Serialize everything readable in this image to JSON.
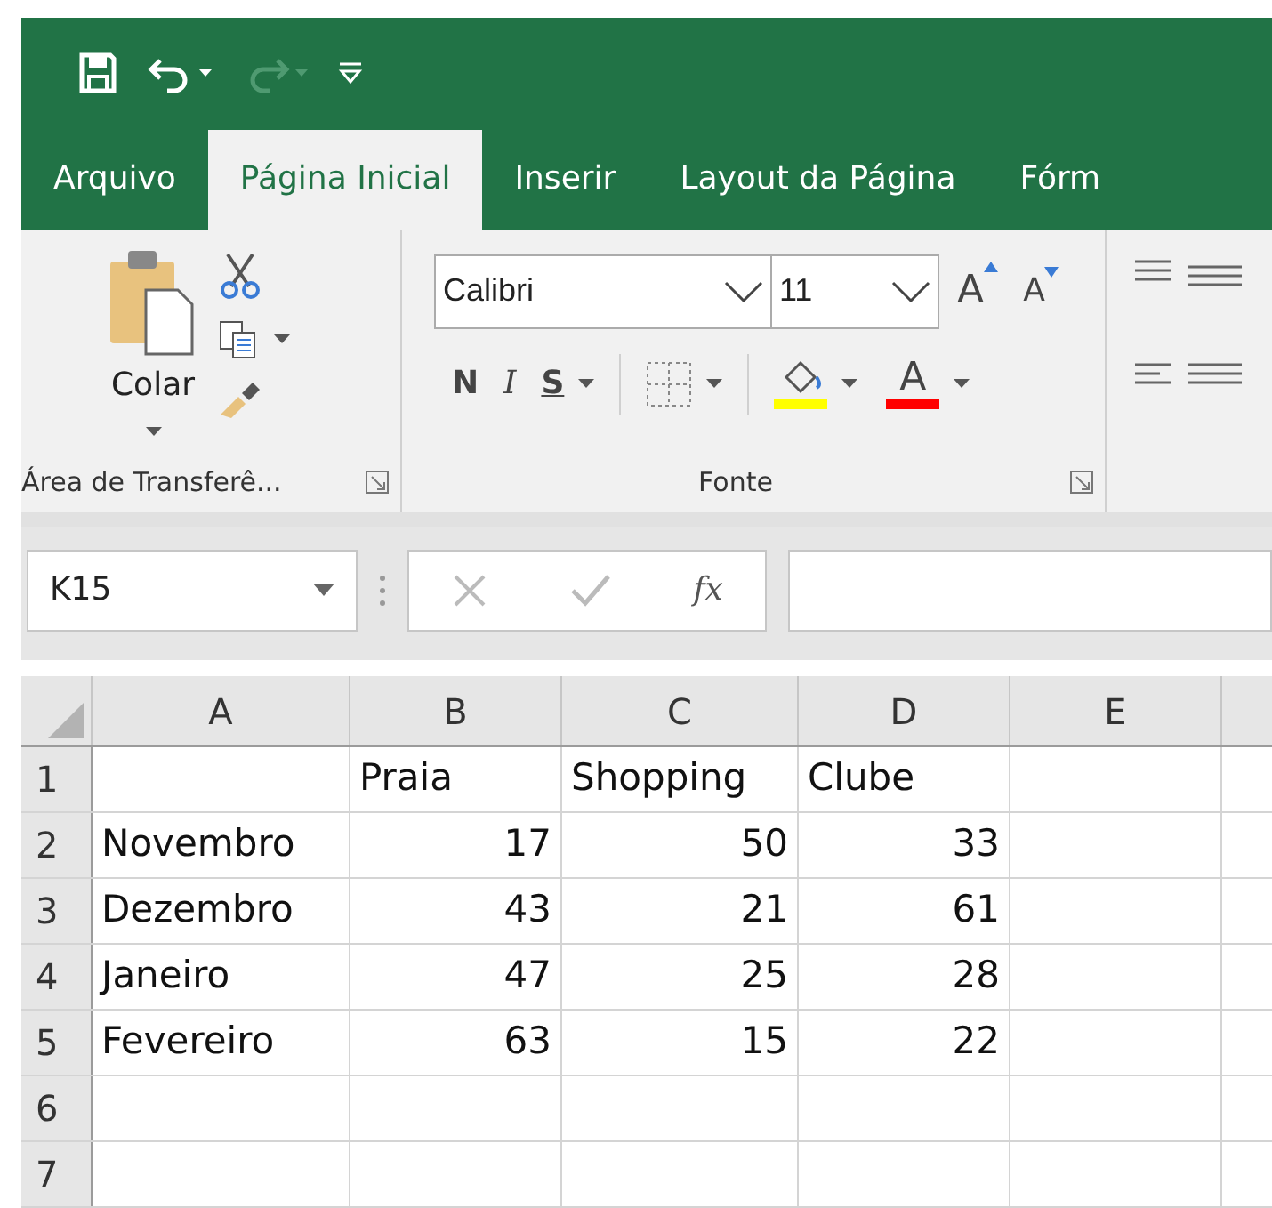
{
  "quick_access": {
    "undo_enabled": true,
    "redo_enabled": false
  },
  "tabs": [
    {
      "label": "Arquivo",
      "selected": false
    },
    {
      "label": "Página Inicial",
      "selected": true
    },
    {
      "label": "Inserir",
      "selected": false
    },
    {
      "label": "Layout da Página",
      "selected": false
    },
    {
      "label": "Fórm",
      "selected": false
    }
  ],
  "ribbon": {
    "clipboard": {
      "paste_label": "Colar",
      "group_label": "Área de Transferê..."
    },
    "font": {
      "font_name": "Calibri",
      "font_size": "11",
      "grow_label": "A",
      "shrink_label": "A",
      "bold_label": "N",
      "italic_label": "I",
      "underline_label": "S",
      "font_color_label": "A",
      "group_label": "Fonte"
    }
  },
  "formula_bar": {
    "name_box": "K15",
    "function_label": "fx"
  },
  "sheet": {
    "columns": [
      "A",
      "B",
      "C",
      "D",
      "E"
    ],
    "rows": [
      {
        "header": "1",
        "cells": [
          "",
          "Praia",
          "Shopping",
          "Clube",
          ""
        ]
      },
      {
        "header": "2",
        "cells": [
          "Novembro",
          "17",
          "50",
          "33",
          ""
        ]
      },
      {
        "header": "3",
        "cells": [
          "Dezembro",
          "43",
          "21",
          "61",
          ""
        ]
      },
      {
        "header": "4",
        "cells": [
          "Janeiro",
          "47",
          "25",
          "28",
          ""
        ]
      },
      {
        "header": "5",
        "cells": [
          "Fevereiro",
          "63",
          "15",
          "22",
          ""
        ]
      },
      {
        "header": "6",
        "cells": [
          "",
          "",
          "",
          "",
          ""
        ]
      },
      {
        "header": "7",
        "cells": [
          "",
          "",
          "",
          "",
          ""
        ]
      }
    ]
  }
}
